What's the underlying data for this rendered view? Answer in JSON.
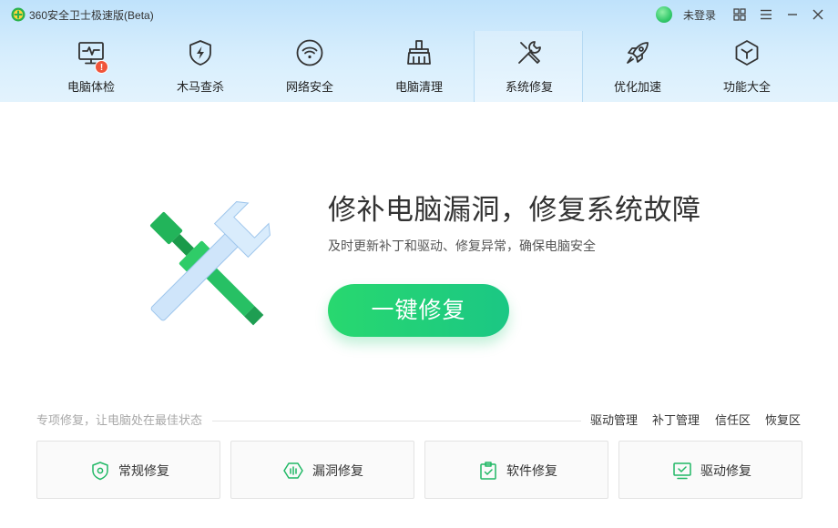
{
  "window": {
    "title": "360安全卫士极速版(Beta)",
    "login_label": "未登录",
    "accent_color": "#1dc97c"
  },
  "nav": {
    "items": [
      {
        "label": "电脑体检",
        "icon": "monitor-pulse-icon",
        "badge": "!"
      },
      {
        "label": "木马查杀",
        "icon": "shield-bolt-icon"
      },
      {
        "label": "网络安全",
        "icon": "wifi-icon"
      },
      {
        "label": "电脑清理",
        "icon": "broom-icon"
      },
      {
        "label": "系统修复",
        "icon": "wrench-screwdriver-icon",
        "active": true
      },
      {
        "label": "优化加速",
        "icon": "rocket-icon"
      },
      {
        "label": "功能大全",
        "icon": "hexagon-cube-icon"
      }
    ]
  },
  "hero": {
    "title": "修补电脑漏洞，修复系统故障",
    "subtitle": "及时更新补丁和驱动、修复异常，确保电脑安全",
    "button_label": "一键修复"
  },
  "section": {
    "label": "专项修复，让电脑处在最佳状态",
    "links": [
      "驱动管理",
      "补丁管理",
      "信任区",
      "恢复区"
    ],
    "cards": [
      {
        "label": "常规修复",
        "icon": "shield-icon"
      },
      {
        "label": "漏洞修复",
        "icon": "hexagon-bug-icon"
      },
      {
        "label": "软件修复",
        "icon": "clipboard-check-icon"
      },
      {
        "label": "驱动修复",
        "icon": "monitor-driver-icon"
      }
    ]
  }
}
